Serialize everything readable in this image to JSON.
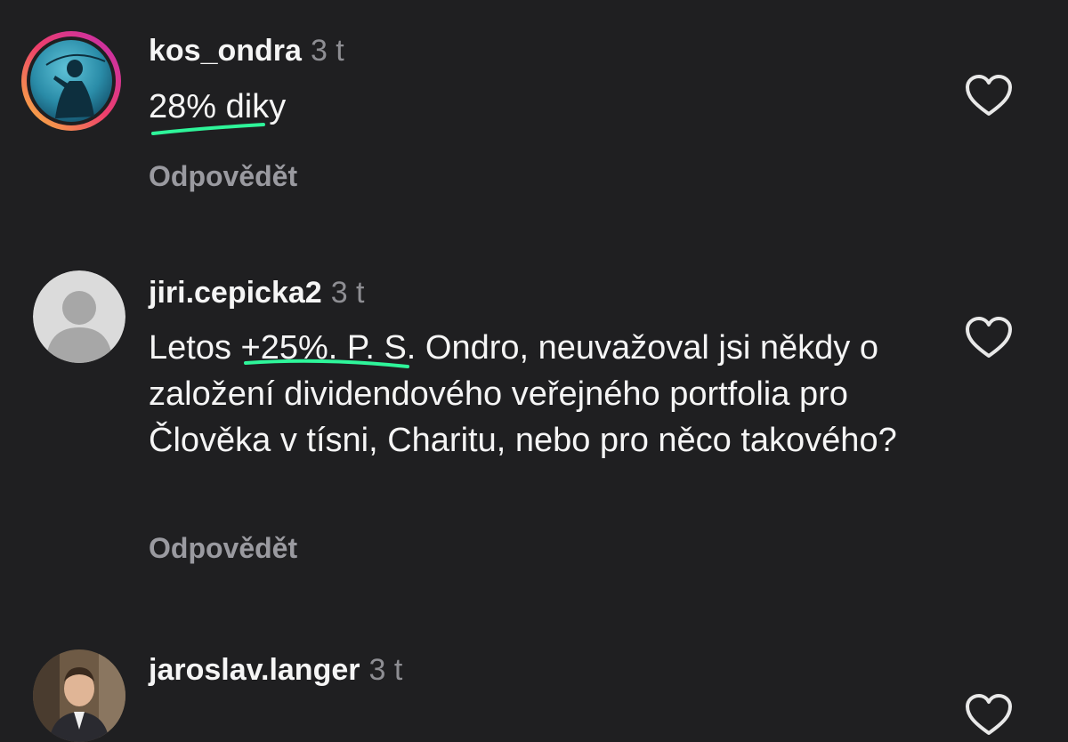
{
  "comments": [
    {
      "username": "kos_ondra",
      "time": "3 t",
      "text": "28% diky",
      "reply_label": "Odpovědět"
    },
    {
      "username": "jiri.cepicka2",
      "time": "3 t",
      "text": "Letos +25%. P. S. Ondro, neuvažoval jsi někdy o založení dividendového veřejného portfolia pro Člověka v tísni, Charitu, nebo pro něco takového?",
      "reply_label": "Odpovědět"
    },
    {
      "username": "jaroslav.langer",
      "time": "3 t",
      "text": "",
      "reply_label": ""
    }
  ],
  "colors": {
    "background": "#1f1f21",
    "highlight_underline": "#2ef59a",
    "story_ring_start": "#f9c23c",
    "story_ring_end": "#e1306c"
  },
  "icons": {
    "like": "heart-icon"
  }
}
